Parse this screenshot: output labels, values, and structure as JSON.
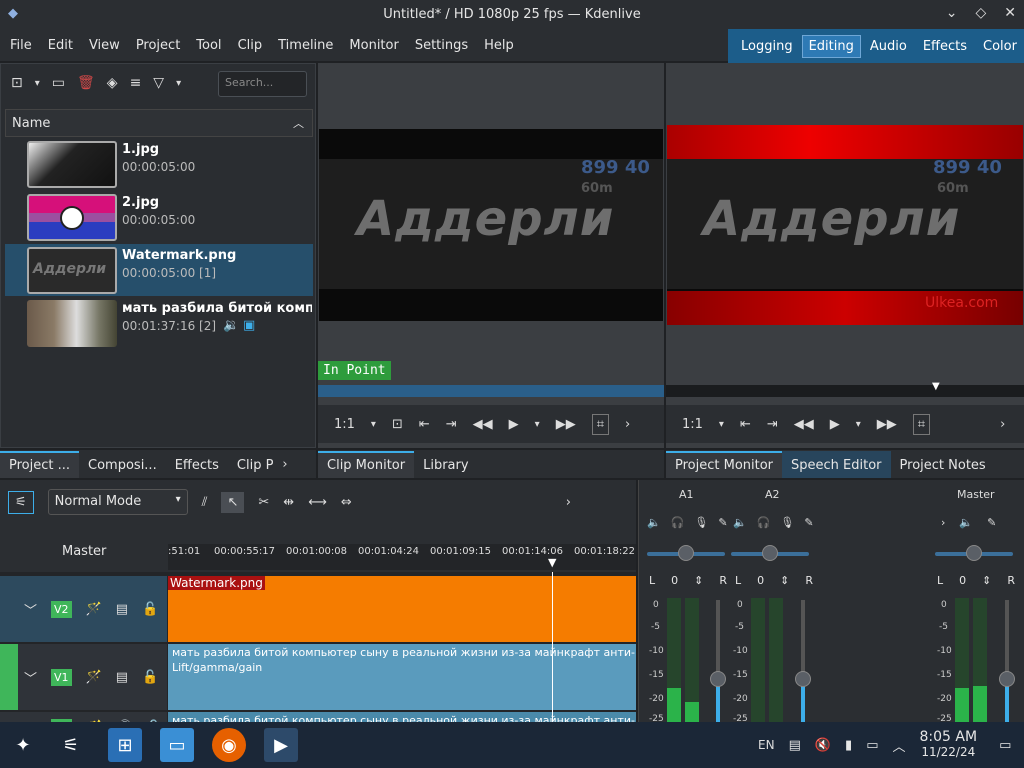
{
  "window": {
    "title": "Untitled* / HD 1080p 25 fps — Kdenlive"
  },
  "menu": [
    "File",
    "Edit",
    "View",
    "Project",
    "Tool",
    "Clip",
    "Timeline",
    "Monitor",
    "Settings",
    "Help"
  ],
  "layouts": {
    "items": [
      "Logging",
      "Editing",
      "Audio",
      "Effects",
      "Color"
    ],
    "active": "Editing"
  },
  "bin": {
    "search_placeholder": "Search...",
    "column_name": "Name",
    "clips": [
      {
        "name": "1.jpg",
        "duration": "00:00:05:00"
      },
      {
        "name": "2.jpg",
        "duration": "00:00:05:00"
      },
      {
        "name": "Watermark.png",
        "duration": "00:00:05:00 [1]"
      },
      {
        "name": "мать разбила битой компьютер сыну",
        "duration": "00:01:37:16 [2]"
      }
    ],
    "tabs": [
      "Project ...",
      "Composi...",
      "Effects",
      "Clip P"
    ]
  },
  "clip_monitor": {
    "overlay_text": "Аддерли",
    "number_text": "899 40",
    "sub_text": "60m",
    "in_point_label": "In Point",
    "zoom": "1:1",
    "tabs": [
      "Clip Monitor",
      "Library"
    ]
  },
  "project_monitor": {
    "overlay_text": "Аддерли",
    "number_text": "899 40",
    "sub_text": "60m",
    "watermark": "Ulkea.com",
    "zoom": "1:1",
    "tabs": [
      "Project Monitor",
      "Speech Editor",
      "Project Notes"
    ]
  },
  "timeline": {
    "mode": "Normal Mode",
    "master_label": "Master",
    "ruler": [
      ":51:01",
      "00:00:55:17",
      "00:01:00:08",
      "00:01:04:24",
      "00:01:09:15",
      "00:01:14:06",
      "00:01:18:22"
    ],
    "tracks": [
      {
        "tag": "V2",
        "clip": "Watermark.png"
      },
      {
        "tag": "V1",
        "clip": "мать разбила битой компьютер сыну в реальной жизни из-за майнкрафт анти-грифе",
        "effect": "Lift/gamma/gain"
      },
      {
        "tag": "A1",
        "clip": "мать разбила битой компьютер сыну в реальной жизни из-за майнкрафт анти-грифе"
      }
    ]
  },
  "mixer": {
    "channels": [
      "A1",
      "A2",
      "Master"
    ],
    "lr": [
      "L",
      "0",
      "R"
    ],
    "db_scale": [
      "0",
      "-5",
      "-10",
      "-15",
      "-20",
      "-25"
    ]
  },
  "taskbar": {
    "lang": "EN",
    "time": "8:05 AM",
    "date": "11/22/24"
  },
  "colors": {
    "accent": "#3daee9",
    "v2_clip": "#f57c00",
    "v1_clip": "#5a9bbd",
    "track_tag": "#3fb65a"
  }
}
